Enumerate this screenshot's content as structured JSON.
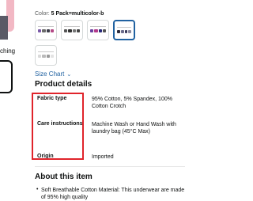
{
  "left": {
    "partial_text": "ching"
  },
  "color": {
    "label": "Color:",
    "value": "5 Pack=multicolor-b",
    "swatches": [
      {
        "colors": [
          "#7a5aa8",
          "#6b6b6b",
          "#3d3d4a",
          "#b44a86"
        ],
        "selected": false
      },
      {
        "colors": [
          "#555555",
          "#333333",
          "#777777",
          "#444444"
        ],
        "selected": false
      },
      {
        "colors": [
          "#6a3fa0",
          "#b23a8a",
          "#2a2a7a",
          "#555555"
        ],
        "selected": false
      },
      {
        "colors": [
          "#2c2c3c",
          "#6c6c8c",
          "#3a3a5a",
          "#8a8aa0"
        ],
        "selected": true
      },
      {
        "colors": [
          "#d9d9d9",
          "#bbbbbb",
          "#9a9a9a",
          "#e3e3e3"
        ],
        "selected": false
      }
    ]
  },
  "size_chart": {
    "label": "Size Chart"
  },
  "product_details": {
    "title": "Product details",
    "rows": [
      {
        "label": "Fabric type",
        "value": "95% Cotton, 5% Spandex, 100% Cotton Crotch"
      },
      {
        "label": "Care instructions",
        "value": "Machine Wash or Hand Wash with laundry bag (45°C Max)"
      },
      {
        "label": "Origin",
        "value": "Imported"
      }
    ]
  },
  "about": {
    "title": "About this item",
    "bullets": [
      "Soft Breathable Cotton Material: This underwear are made of 95% high quality"
    ]
  }
}
